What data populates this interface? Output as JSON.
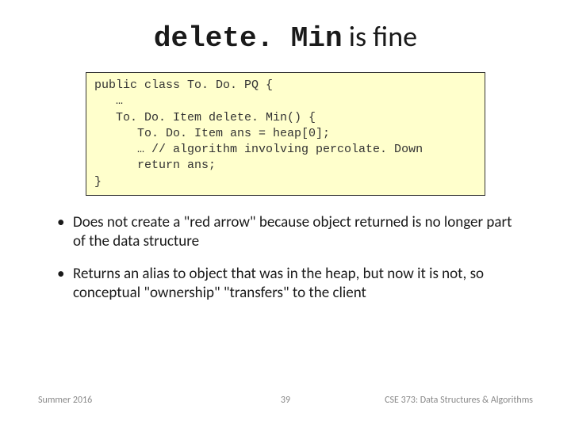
{
  "title": {
    "mono": "delete. Min",
    "rest": " is fine"
  },
  "code": "public class To. Do. PQ {\n   …\n   To. Do. Item delete. Min() {\n      To. Do. Item ans = heap[0];\n      … // algorithm involving percolate. Down\n      return ans;\n}",
  "bullets": [
    "Does not create a \"red arrow\" because object returned is no longer part of the data structure",
    "Returns an alias to object that was in the heap, but now it is not, so conceptual \"ownership\" \"transfers\" to the client"
  ],
  "footer": {
    "left": "Summer 2016",
    "center": "39",
    "right": "CSE 373: Data Structures & Algorithms"
  }
}
